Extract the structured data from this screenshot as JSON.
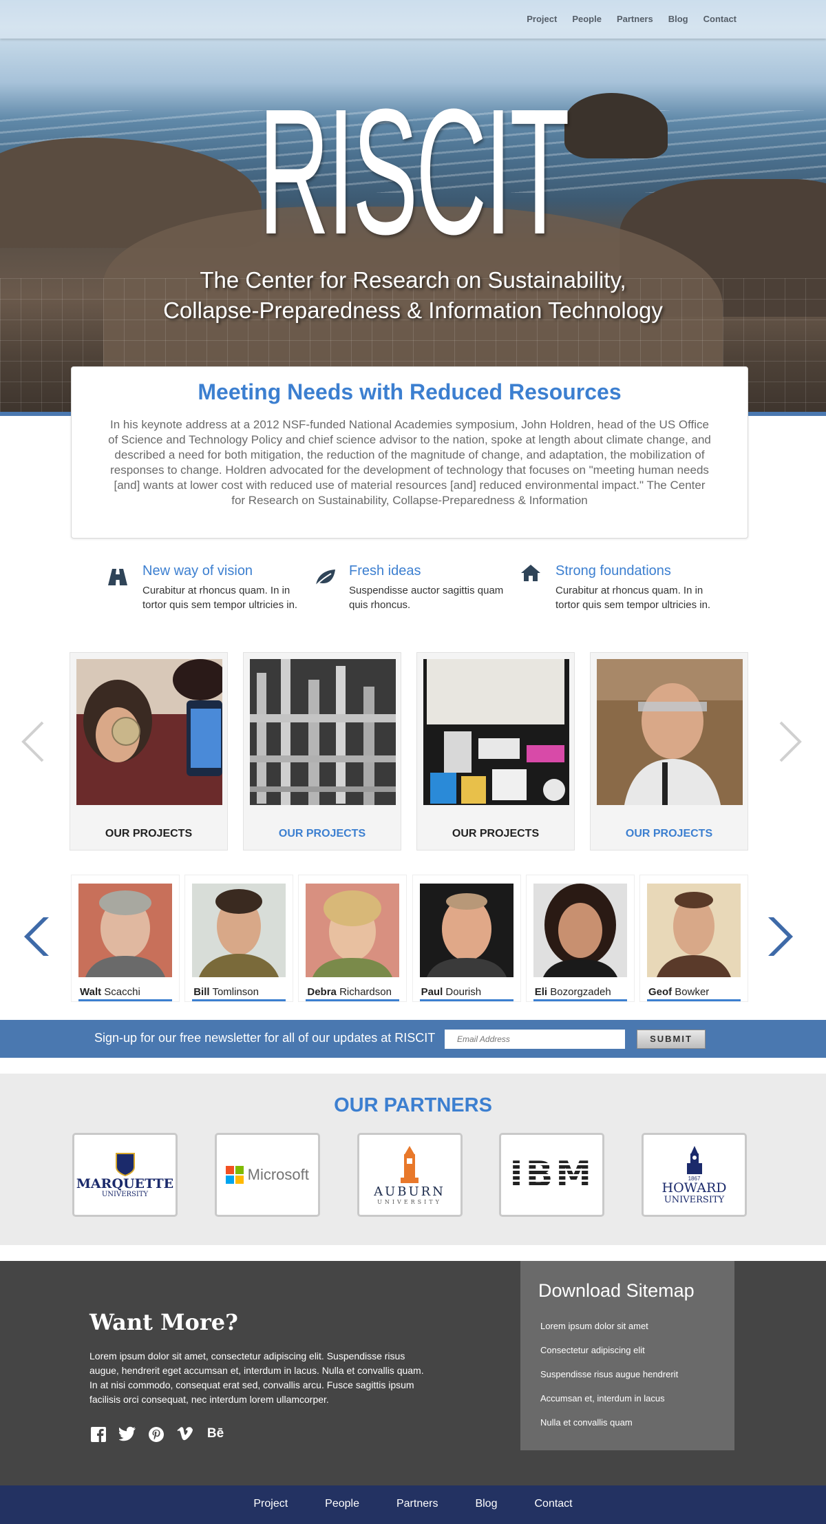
{
  "nav": {
    "items": [
      "Project",
      "People",
      "Partners",
      "Blog",
      "Contact"
    ]
  },
  "hero": {
    "brand": "RISCIT",
    "tagline_line1": "The Center for Research on Sustainability,",
    "tagline_line2": "Collapse-Preparedness & Information Technology"
  },
  "intro": {
    "title": "Meeting Needs with Reduced Resources",
    "body": "In his keynote address at a 2012 NSF-funded National Academies symposium, John Holdren, head of the US Office of Science and Technology Policy and chief science advisor to the nation, spoke at length about climate change, and described a need for both mitigation, the reduction of the magnitude of change, and adaptation, the mobilization of responses to change. Holdren advocated for the development of technology that focuses on \"meeting human needs [and] wants at lower cost with reduced use of material resources [and] reduced environmental impact.\" The Center for Research on Sustainability, Collapse-Preparedness & Information"
  },
  "features": [
    {
      "icon": "road-icon",
      "title": "New way of vision",
      "text": "Curabitur at rhoncus quam. In in tortor quis sem tempor ultricies in."
    },
    {
      "icon": "leaf-icon",
      "title": "Fresh ideas",
      "text": "Suspendisse auctor sagittis quam quis rhoncus."
    },
    {
      "icon": "home-icon",
      "title": "Strong foundations",
      "text": "Curabitur at rhoncus quam. In in tortor quis sem tempor ultricies in."
    }
  ],
  "projects": [
    {
      "label": "OUR PROJECTS",
      "color": "#222222"
    },
    {
      "label": "OUR PROJECTS",
      "color": "#3c7fd0"
    },
    {
      "label": "OUR PROJECTS",
      "color": "#222222"
    },
    {
      "label": "OUR PROJECTS",
      "color": "#3c7fd0"
    }
  ],
  "people": [
    {
      "first": "Walt",
      "last": "Scacchi"
    },
    {
      "first": "Bill",
      "last": "Tomlinson"
    },
    {
      "first": "Debra",
      "last": "Richardson"
    },
    {
      "first": "Paul",
      "last": "Dourish"
    },
    {
      "first": "Eli",
      "last": "Bozorgzadeh"
    },
    {
      "first": "Geof",
      "last": "Bowker"
    }
  ],
  "newsletter": {
    "text": "Sign-up for our free newsletter for all of our updates at RISCIT",
    "placeholder": "Email Address",
    "submit": "SUBMIT"
  },
  "partners": {
    "title": "OUR PARTNERS",
    "marquette": {
      "name": "MARQUETTE",
      "sub": "UNIVERSITY"
    },
    "microsoft": {
      "name": "Microsoft"
    },
    "auburn": {
      "name": "AUBURN",
      "sub": "UNIVERSITY"
    },
    "ibm": {
      "name": "IBM"
    },
    "howard": {
      "year": "1867",
      "name": "HOWARD",
      "sub": "UNIVERSITY"
    }
  },
  "footer": {
    "title": "Want More?",
    "body": "Lorem ipsum dolor sit amet, consectetur adipiscing elit. Suspendisse risus augue, hendrerit eget accumsan et, interdum in lacus. Nulla et convallis quam. In at nisi commodo, consequat erat sed, convallis arcu. Fusce sagittis ipsum facilisis orci consequat, nec interdum lorem ullamcorper.",
    "socials": [
      "facebook-icon",
      "twitter-icon",
      "pinterest-icon",
      "vimeo-icon",
      "behance-icon"
    ],
    "behance_label": "Bē",
    "sitemap_title": "Download Sitemap",
    "sitemap_items": [
      "Lorem ipsum dolor sit amet",
      "Consectetur adipiscing elit",
      "Suspendisse risus augue hendrerit",
      "Accumsan et, interdum in lacus",
      "Nulla et convallis quam"
    ]
  },
  "colors": {
    "accent": "#3c7fd0",
    "newsletter_bg": "#4a78b0",
    "footer_bg": "#454545",
    "bottom_nav_bg": "#233262"
  }
}
